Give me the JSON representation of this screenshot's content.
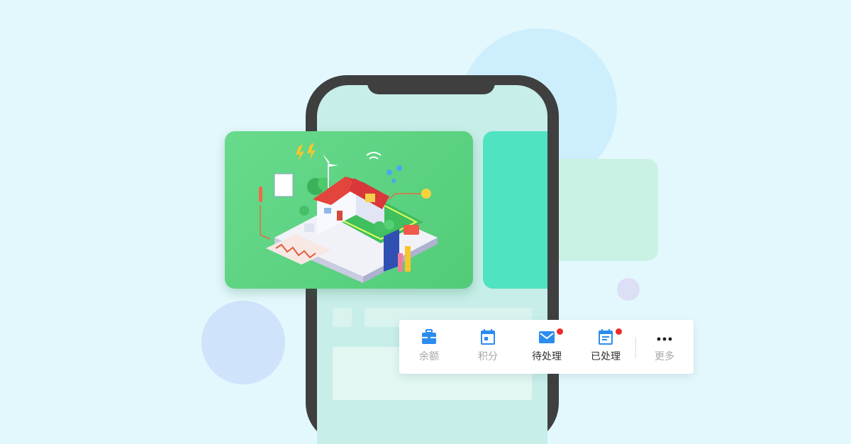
{
  "toolbar": {
    "items": [
      {
        "label": "余额",
        "icon": "wallet-icon"
      },
      {
        "label": "积分",
        "icon": "calendar-icon"
      },
      {
        "label": "待处理",
        "icon": "mail-icon",
        "badge": true
      },
      {
        "label": "已处理",
        "icon": "calendar-list-icon",
        "badge": true
      },
      {
        "label": "更多",
        "icon": "more-icon"
      }
    ]
  },
  "colors": {
    "background": "#e3f8fc",
    "phone_frame": "#3f3f3f",
    "banner_green": "#5dd482",
    "next_card": "#4fe3c2",
    "icon_blue": "#2b8cf0",
    "badge_red": "#ee2c2c"
  }
}
